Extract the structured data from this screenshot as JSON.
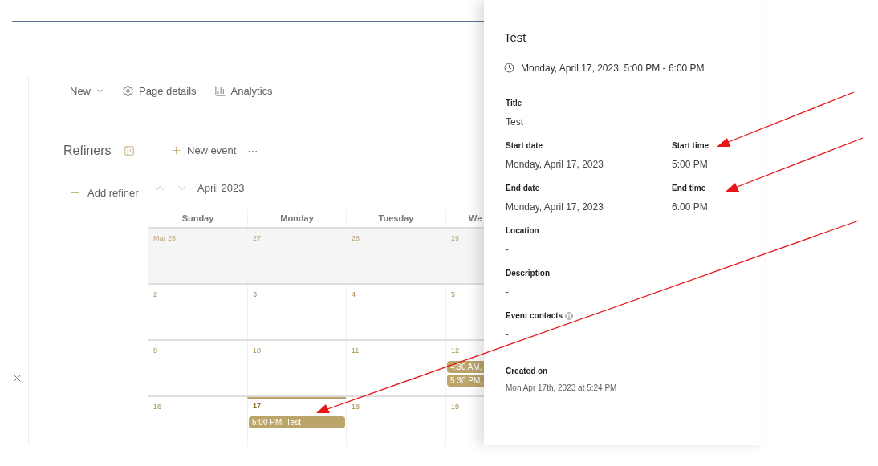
{
  "command_bar": [
    {
      "kind": "new",
      "label": "New"
    },
    {
      "kind": "settings",
      "label": "Page details"
    },
    {
      "kind": "analytics",
      "label": "Analytics"
    }
  ],
  "refiners": {
    "title": "Refiners",
    "add_label": "Add refiner"
  },
  "calendar": {
    "new_event": "New event",
    "more": "···",
    "month": "April 2023",
    "weekdays": [
      "Sunday",
      "Monday",
      "Tuesday",
      "We"
    ],
    "weeks": [
      {
        "days": [
          {
            "date": "Mar 26",
            "other_month": true,
            "today": false
          },
          {
            "date": "27",
            "other_month": true,
            "today": false
          },
          {
            "date": "28",
            "other_month": true,
            "today": false
          },
          {
            "date": "29",
            "other_month": true,
            "today": false
          }
        ]
      },
      {
        "days": [
          {
            "date": "2",
            "other_month": false,
            "today": false
          },
          {
            "date": "3",
            "other_month": false,
            "today": false
          },
          {
            "date": "4",
            "other_month": false,
            "today": false
          },
          {
            "date": "5",
            "other_month": false,
            "today": false
          }
        ]
      },
      {
        "days": [
          {
            "date": "9",
            "other_month": false,
            "today": false
          },
          {
            "date": "10",
            "other_month": false,
            "today": false
          },
          {
            "date": "11",
            "other_month": false,
            "today": false
          },
          {
            "date": "12",
            "other_month": false,
            "today": false,
            "events": [
              "4:30 AM,",
              "5:30 PM,"
            ]
          }
        ]
      },
      {
        "days": [
          {
            "date": "16",
            "other_month": false,
            "today": false
          },
          {
            "date": "17",
            "other_month": false,
            "today": true,
            "events": [
              "5:00 PM, Test"
            ]
          },
          {
            "date": "18",
            "other_month": false,
            "today": false
          },
          {
            "date": "19",
            "other_month": false,
            "today": false
          }
        ]
      }
    ]
  },
  "panel": {
    "title": "Test",
    "when": "Monday, April 17, 2023, 5:00 PM - 6:00 PM",
    "rows": [
      [
        {
          "label": "Title",
          "value": "Test"
        }
      ],
      [
        {
          "label": "Start date",
          "value": "Monday, April 17, 2023"
        },
        {
          "label": "Start time",
          "value": "5:00 PM"
        }
      ],
      [
        {
          "label": "End date",
          "value": "Monday, April 17, 2023"
        },
        {
          "label": "End time",
          "value": "6:00 PM"
        }
      ],
      [
        {
          "label": "Location",
          "value": "-"
        }
      ],
      [
        {
          "label": "Description",
          "value": "-"
        }
      ],
      [
        {
          "label": "Event contacts",
          "value": "-",
          "info": true
        }
      ]
    ],
    "created": {
      "label": "Created on",
      "value": "Mon Apr 17th, 2023 at 5:24 PM"
    }
  }
}
